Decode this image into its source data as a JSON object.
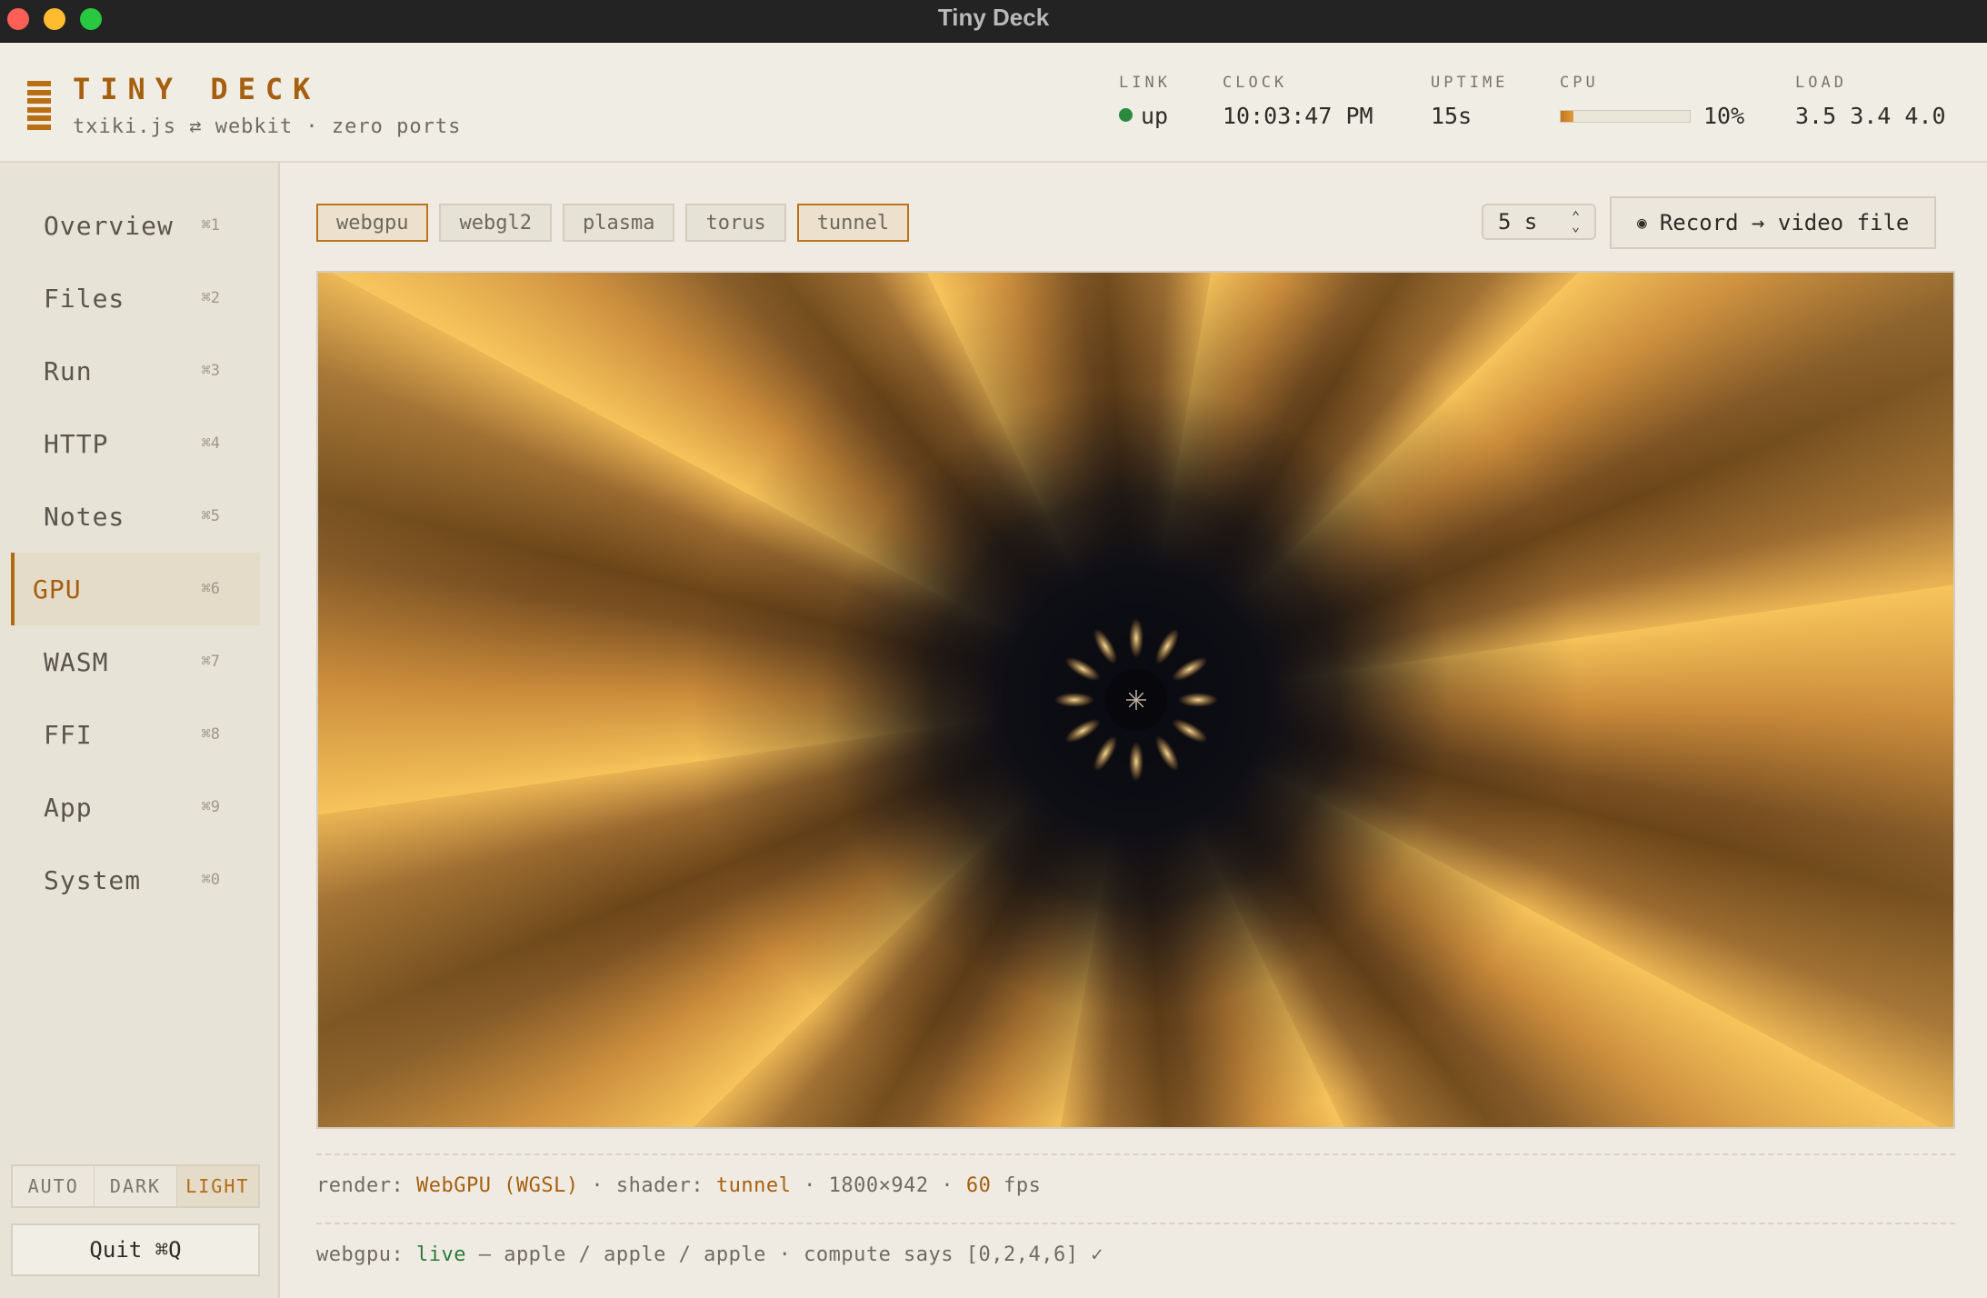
{
  "window": {
    "title": "Tiny Deck"
  },
  "brand": {
    "title": "TINY DECK",
    "subtitle": "txiki.js ⇄ webkit · zero ports"
  },
  "stats": {
    "link": {
      "label": "LINK",
      "value": "up"
    },
    "clock": {
      "label": "CLOCK",
      "value": "10:03:47 PM"
    },
    "uptime": {
      "label": "UPTIME",
      "value": "15s"
    },
    "cpu": {
      "label": "CPU",
      "value": "10%",
      "fraction": 0.1
    },
    "load": {
      "label": "LOAD",
      "value": "3.5 3.4 4.0"
    }
  },
  "nav": [
    {
      "label": "Overview",
      "key": "⌘1"
    },
    {
      "label": "Files",
      "key": "⌘2"
    },
    {
      "label": "Run",
      "key": "⌘3"
    },
    {
      "label": "HTTP",
      "key": "⌘4"
    },
    {
      "label": "Notes",
      "key": "⌘5"
    },
    {
      "label": "GPU",
      "key": "⌘6",
      "active": true
    },
    {
      "label": "WASM",
      "key": "⌘7"
    },
    {
      "label": "FFI",
      "key": "⌘8"
    },
    {
      "label": "App",
      "key": "⌘9"
    },
    {
      "label": "System",
      "key": "⌘0"
    }
  ],
  "theme": {
    "auto": "AUTO",
    "dark": "DARK",
    "light": "LIGHT",
    "selected": "LIGHT"
  },
  "quit": {
    "label": "Quit ⌘Q"
  },
  "toolbar": {
    "chips": [
      "webgpu",
      "webgl2",
      "plasma",
      "torus",
      "tunnel"
    ],
    "active_chips": [
      "webgpu",
      "tunnel"
    ],
    "duration": "5 s",
    "record_label": "Record → video file",
    "record_icon": "◉"
  },
  "status": {
    "render_label": "render:",
    "render_value": "WebGPU (WGSL)",
    "shader_label": "shader:",
    "shader_value": "tunnel",
    "resolution": "1800×942",
    "fps_value": "60",
    "fps_unit": "fps",
    "backend_label": "webgpu:",
    "backend_state": "live",
    "adapter": "— apple / apple / apple",
    "compute": "compute says [0,2,4,6] ✓"
  },
  "colors": {
    "accent": "#a65f0f",
    "live": "#2a7a3a",
    "link_up": "#2a8a3e"
  }
}
